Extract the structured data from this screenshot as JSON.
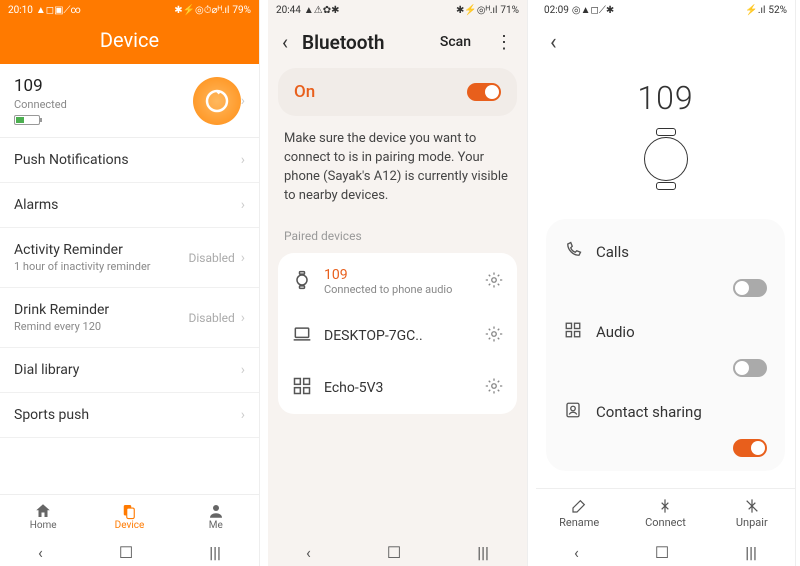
{
  "phone1": {
    "status": {
      "time": "20:10",
      "icons_left": "▲◻▣⟋∞",
      "icons_right": "✱⚡◎⏱⌀ᴴ.ıl",
      "battery": "79%"
    },
    "header": "Device",
    "device": {
      "name": "109",
      "status": "Connected",
      "battery_pct": 35
    },
    "items": [
      {
        "title": "Push Notifications",
        "sub": "",
        "value": ""
      },
      {
        "title": "Alarms",
        "sub": "",
        "value": ""
      },
      {
        "title": "Activity Reminder",
        "sub": "1 hour of inactivity reminder",
        "value": "Disabled"
      },
      {
        "title": "Drink Reminder",
        "sub": "Remind every 120",
        "value": "Disabled"
      },
      {
        "title": "Dial library",
        "sub": "",
        "value": ""
      },
      {
        "title": "Sports push",
        "sub": "",
        "value": ""
      }
    ],
    "nav": {
      "home": "Home",
      "device": "Device",
      "me": "Me"
    }
  },
  "phone2": {
    "status": {
      "time": "20:44",
      "icons_left": "▲⚠✿✱",
      "icons_right": "✱⚡◎ᴴ.ıl",
      "battery": "71%"
    },
    "title": "Bluetooth",
    "scan": "Scan",
    "on_label": "On",
    "on_state": true,
    "info": "Make sure the device you want to connect to is in pairing mode. Your phone (Sayak's A12) is currently visible to nearby devices.",
    "section": "Paired devices",
    "paired": [
      {
        "icon": "watch",
        "name": "109",
        "sub": "Connected to phone audio",
        "highlight": true
      },
      {
        "icon": "laptop",
        "name": "DESKTOP-7GC..",
        "sub": "",
        "highlight": false
      },
      {
        "icon": "qr",
        "name": "Echo-5V3",
        "sub": "",
        "highlight": false
      }
    ]
  },
  "phone3": {
    "status": {
      "time": "02:09",
      "icons_left": "◎▲◻⟋✱",
      "icons_right": "⚡.ıl",
      "battery": "52%"
    },
    "device_name": "109",
    "rows": [
      {
        "icon": "phone",
        "label": "Calls",
        "on": false
      },
      {
        "icon": "qr",
        "label": "Audio",
        "on": false
      },
      {
        "icon": "contact",
        "label": "Contact sharing",
        "on": true
      }
    ],
    "actions": {
      "rename": "Rename",
      "connect": "Connect",
      "unpair": "Unpair"
    }
  }
}
